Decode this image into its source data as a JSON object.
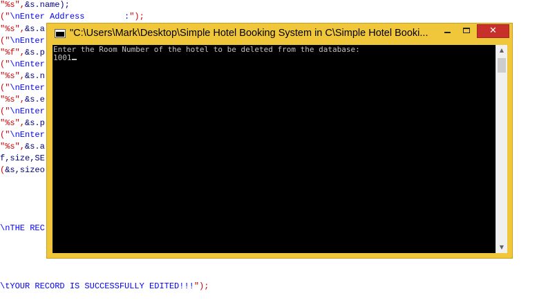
{
  "editor": {
    "lines": [
      {
        "parts": [
          {
            "c": "tok-red",
            "t": "\"%s\","
          },
          {
            "c": "tok-blk",
            "t": "&s.name);"
          }
        ]
      },
      {
        "parts": [
          {
            "c": "tok-red",
            "t": "(\""
          },
          {
            "c": "tok-str",
            "t": "\\nEnter Address        :"
          },
          {
            "c": "tok-red",
            "t": "\");"
          }
        ]
      },
      {
        "parts": [
          {
            "c": "tok-red",
            "t": "\"%s\","
          },
          {
            "c": "tok-blk",
            "t": "&s.a"
          }
        ]
      },
      {
        "parts": [
          {
            "c": "tok-red",
            "t": "(\""
          },
          {
            "c": "tok-str",
            "t": "\\nEnter"
          }
        ]
      },
      {
        "parts": [
          {
            "c": "tok-red",
            "t": "\"%f\","
          },
          {
            "c": "tok-blk",
            "t": "&s.p"
          }
        ]
      },
      {
        "parts": [
          {
            "c": "tok-red",
            "t": "(\""
          },
          {
            "c": "tok-str",
            "t": "\\nEnter"
          }
        ]
      },
      {
        "parts": [
          {
            "c": "tok-red",
            "t": "\"%s\","
          },
          {
            "c": "tok-blk",
            "t": "&s.n"
          }
        ]
      },
      {
        "parts": [
          {
            "c": "tok-red",
            "t": "(\""
          },
          {
            "c": "tok-str",
            "t": "\\nEnter"
          }
        ]
      },
      {
        "parts": [
          {
            "c": "tok-red",
            "t": "\"%s\","
          },
          {
            "c": "tok-blk",
            "t": "&s.e"
          }
        ]
      },
      {
        "parts": [
          {
            "c": "tok-red",
            "t": "(\""
          },
          {
            "c": "tok-str",
            "t": "\\nEnter"
          }
        ]
      },
      {
        "parts": [
          {
            "c": "tok-red",
            "t": "\"%s\","
          },
          {
            "c": "tok-blk",
            "t": "&s.p"
          }
        ]
      },
      {
        "parts": [
          {
            "c": "tok-red",
            "t": "(\""
          },
          {
            "c": "tok-str",
            "t": "\\nEnter"
          }
        ]
      },
      {
        "parts": [
          {
            "c": "tok-red",
            "t": "\"%s\","
          },
          {
            "c": "tok-blk",
            "t": "&s.a"
          }
        ]
      },
      {
        "parts": [
          {
            "c": "tok-blk",
            "t": "f,size,SE"
          }
        ]
      },
      {
        "parts": [
          {
            "c": "tok-red",
            "t": "("
          },
          {
            "c": "tok-blk",
            "t": "&s,sizeo"
          }
        ]
      },
      {
        "parts": [
          {
            "c": "tok-str",
            "t": "\\nTHE REC"
          }
        ]
      },
      {
        "parts": [
          {
            "c": "tok-str",
            "t": "\\tYOUR RECORD IS SUCCESSFULLY EDITED!!!"
          },
          {
            "c": "tok-red",
            "t": "\");"
          }
        ]
      }
    ]
  },
  "window": {
    "title": "\"C:\\Users\\Mark\\Desktop\\Simple Hotel Booking System in C\\Simple Hotel Booki...",
    "minimize_label": "Minimize",
    "maximize_label": "Maximize",
    "close_symbol": "✕",
    "icon": "console-window-icon"
  },
  "console": {
    "prompt": "Enter the Room Number of the hotel to be deleted from the database:",
    "input_value": "1001"
  },
  "scrollbar": {
    "up_arrow": "▲",
    "down_arrow": "▼"
  },
  "colors": {
    "window_frame": "#f0c63a",
    "close_button": "#c7302b",
    "console_background": "#000000",
    "console_text": "#c0c0c0",
    "code_string": "#0000ff",
    "code_red": "#cc0000"
  }
}
